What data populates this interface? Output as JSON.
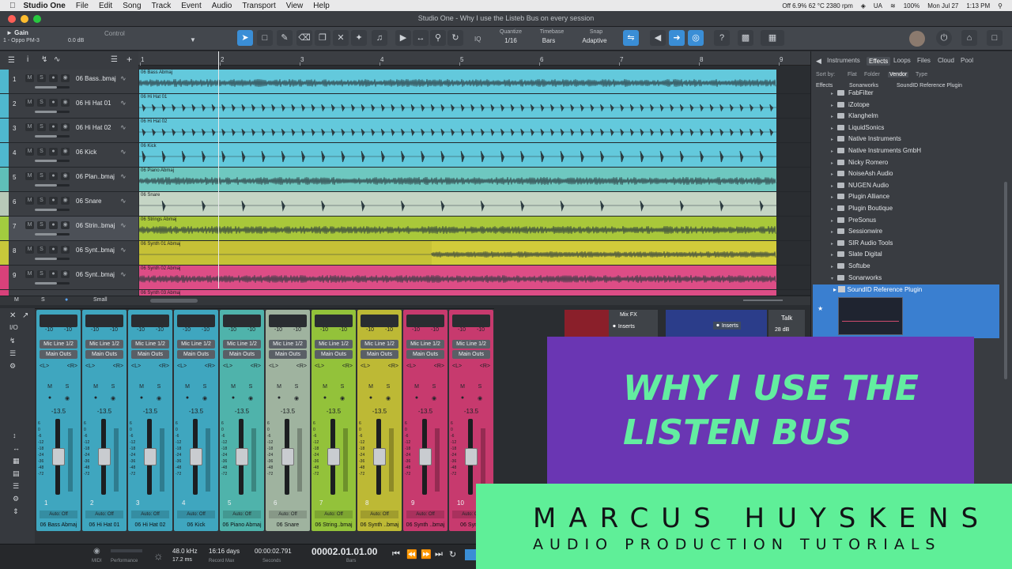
{
  "menubar": {
    "app": "Studio One",
    "items": [
      "File",
      "Edit",
      "Song",
      "Track",
      "Event",
      "Audio",
      "Transport",
      "View",
      "Help"
    ],
    "status": [
      "Off 6.9% 62 °C 2380 rpm",
      "UA",
      "100%",
      "Mon Jul 27",
      "1:13 PM"
    ]
  },
  "window": {
    "title": "Studio One - Why I use the Listeb Bus on every session"
  },
  "toolbar": {
    "gain_label": "Gain",
    "device": "1 - Oppo PM-3",
    "gain_value": "0.0 dB",
    "control_label": "Control",
    "quantize_label": "Quantize",
    "quantize_value": "1/16",
    "timebase_label": "Timebase",
    "timebase_value": "Bars",
    "snap_label": "Snap",
    "snap_value": "Adaptive",
    "iq": "IQ"
  },
  "ruler": {
    "bars": [
      "1",
      "2",
      "3",
      "4",
      "5",
      "6",
      "7",
      "8",
      "9"
    ]
  },
  "tracks": [
    {
      "num": "1",
      "name": "06 Bass..bmaj",
      "clip": "06 Bass Abmaj",
      "color": "#4fb8cf",
      "clipcolor": "#63c9dc",
      "kind": "dense"
    },
    {
      "num": "2",
      "name": "06 Hi Hat 01",
      "clip": "06 Hi Hat 01",
      "color": "#4fb8cf",
      "clipcolor": "#63c9dc",
      "kind": "hits"
    },
    {
      "num": "3",
      "name": "06 Hi Hat 02",
      "clip": "06 Hi Hat 02",
      "color": "#4fb8cf",
      "clipcolor": "#63c9dc",
      "kind": "hits"
    },
    {
      "num": "4",
      "name": "06 Kick",
      "clip": "06 Kick",
      "color": "#4fb8cf",
      "clipcolor": "#63c9dc",
      "kind": "kick"
    },
    {
      "num": "5",
      "name": "06 Plan..bmaj",
      "clip": "06 Piano Abmaj",
      "color": "#5fbfb8",
      "clipcolor": "#6ec8c0",
      "kind": "dense"
    },
    {
      "num": "6",
      "name": "06 Snare",
      "clip": "06 Snare",
      "color": "#b8c9b8",
      "clipcolor": "#c5d5c5",
      "kind": "snare"
    },
    {
      "num": "7",
      "name": "06 Strin..bmaj",
      "clip": "06 Strings Abmaj",
      "color": "#a2cc3f",
      "clipcolor": "#a9c83a",
      "kind": "dense"
    },
    {
      "num": "8",
      "name": "06 Synt..bmaj",
      "clip": "06 Synth 01 Abmaj",
      "color": "#c8c83a",
      "clipcolor": "#d2cc3a",
      "kind": "late"
    },
    {
      "num": "9",
      "name": "06 Synt..bmaj",
      "clip": "06 Synth 02 Abmaj",
      "color": "#d8417a",
      "clipcolor": "#dd4d86",
      "kind": "dense"
    }
  ],
  "track_footer": {
    "m": "M",
    "s": "S",
    "size": "Small",
    "last_clip": "06 Synth 03 Abmaj"
  },
  "browser": {
    "tabs": [
      "Instruments",
      "Effects",
      "Loops",
      "Files",
      "Cloud",
      "Pool"
    ],
    "selected_tab": "Effects",
    "sort_by": "Sort by:",
    "sorts": [
      "Flat",
      "Folder",
      "Vendor",
      "Type"
    ],
    "path": [
      "Effects",
      "Sonarworks",
      "SoundID Reference Plugin"
    ],
    "items": [
      "FabFilter",
      "iZotope",
      "Klanghelm",
      "LiquidSonics",
      "Native Instruments",
      "Native Instruments GmbH",
      "Nicky Romero",
      "NoiseAsh Audio",
      "NUGEN Audio",
      "Plugin Alliance",
      "Plugin Boutique",
      "PreSonus",
      "Sessionwire",
      "SIR Audio Tools",
      "Slate Digital",
      "Softube",
      "Sonarworks"
    ],
    "selected_plugin": "SoundID Reference Plugin"
  },
  "mixer": {
    "strips": [
      {
        "num": "1",
        "name": "06 Bass Abmaj",
        "color": "#3fa6bf"
      },
      {
        "num": "2",
        "name": "06 Hi Hat 01",
        "color": "#3fa6bf"
      },
      {
        "num": "3",
        "name": "06 Hi Hat 02",
        "color": "#3fa6bf"
      },
      {
        "num": "4",
        "name": "06 Kick",
        "color": "#3fa6bf"
      },
      {
        "num": "5",
        "name": "06 Piano Abmaj",
        "color": "#4fb3ab"
      },
      {
        "num": "6",
        "name": "06 Snare",
        "color": "#9fb39f"
      },
      {
        "num": "7",
        "name": "06 String..bmaj",
        "color": "#93c23a"
      },
      {
        "num": "8",
        "name": "06 Synth ..bmaj",
        "color": "#bdb935"
      },
      {
        "num": "9",
        "name": "06 Synth ..bmaj",
        "color": "#c73a6e"
      },
      {
        "num": "10",
        "name": "06 Synth",
        "color": "#c73a6e"
      }
    ],
    "meter_vals": [
      "-10",
      "-10"
    ],
    "input": "Mic Line 1/2",
    "output": "Main Outs",
    "lr": [
      "<L>",
      "<R>"
    ],
    "m": "M",
    "s": "S",
    "volume": "-13.5",
    "auto": "Auto: Off",
    "scale": [
      "6",
      "0",
      "-6",
      "-12",
      "-18",
      "-24",
      "-36",
      "-48",
      "-72"
    ],
    "mixfx": "Mix FX",
    "inserts": "Inserts",
    "talk": "Talk",
    "talk_db": "28 dB"
  },
  "transport": {
    "midi": "MIDI",
    "performance": "Performance",
    "rate": "48.0 kHz",
    "latency": "17.2 ms",
    "days": "16:16 days",
    "recmax": "Record Max",
    "seconds_val": "00:00:02.791",
    "seconds": "Seconds",
    "bars_val": "00002.01.01.00",
    "bars": "Bars"
  },
  "overlay": {
    "line1": "WHY I USE THE",
    "line2": "LISTEN BUS",
    "name": "MARCUS HUYSKENS",
    "subtitle": "AUDIO PRODUCTION TUTORIALS"
  }
}
